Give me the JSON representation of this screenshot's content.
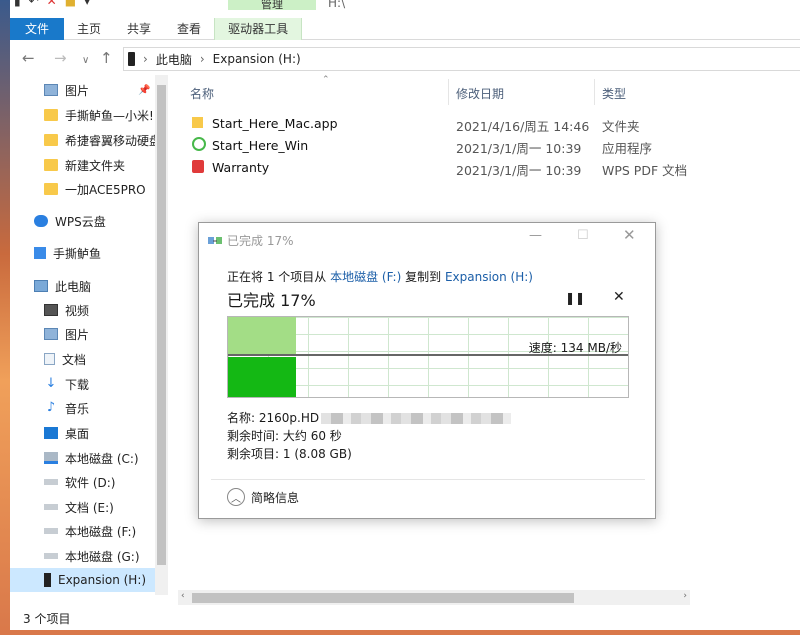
{
  "ribbon": {
    "manage_tab": "管理",
    "path_title": "H:\\",
    "tabs": [
      "文件",
      "主页",
      "共享",
      "查看",
      "驱动器工具"
    ]
  },
  "address": {
    "crumbs": [
      "此电脑",
      "Expansion (H:)"
    ]
  },
  "sidebar": {
    "items": [
      {
        "label": "图片",
        "icon": "pictures-icon",
        "pinned": true
      },
      {
        "label": "手撕鲈鱼—小米!",
        "icon": "folder-icon"
      },
      {
        "label": "希捷睿翼移动硬盘",
        "icon": "folder-icon"
      },
      {
        "label": "新建文件夹",
        "icon": "folder-icon"
      },
      {
        "label": "一加ACE5PRO",
        "icon": "folder-icon"
      },
      {
        "label": "WPS云盘",
        "icon": "cloud-icon"
      },
      {
        "label": "手撕鲈鱼",
        "icon": "cloud-drive-icon"
      },
      {
        "label": "此电脑",
        "icon": "computer-icon"
      },
      {
        "label": "视频",
        "icon": "video-icon"
      },
      {
        "label": "图片",
        "icon": "pictures-icon"
      },
      {
        "label": "文档",
        "icon": "documents-icon"
      },
      {
        "label": "下载",
        "icon": "download-icon"
      },
      {
        "label": "音乐",
        "icon": "music-icon"
      },
      {
        "label": "桌面",
        "icon": "desktop-icon"
      },
      {
        "label": "本地磁盘 (C:)",
        "icon": "windows-drive-icon"
      },
      {
        "label": "软件 (D:)",
        "icon": "drive-icon"
      },
      {
        "label": "文档 (E:)",
        "icon": "drive-icon"
      },
      {
        "label": "本地磁盘 (F:)",
        "icon": "drive-icon"
      },
      {
        "label": "本地磁盘 (G:)",
        "icon": "drive-icon"
      },
      {
        "label": "Expansion (H:)",
        "icon": "usb-drive-icon",
        "selected": true
      }
    ]
  },
  "columns": {
    "name": "名称",
    "date": "修改日期",
    "type": "类型"
  },
  "files": [
    {
      "name": "Start_Here_Mac.app",
      "date": "2021/4/16/周五 14:46",
      "type": "文件夹",
      "icon": "folder-icon"
    },
    {
      "name": "Start_Here_Win",
      "date": "2021/3/1/周一 10:39",
      "type": "应用程序",
      "icon": "seagate-app-icon"
    },
    {
      "name": "Warranty",
      "date": "2021/3/1/周一 10:39",
      "type": "WPS PDF 文档",
      "icon": "pdf-icon"
    }
  ],
  "status": {
    "count": "3 个项目"
  },
  "dialog": {
    "title": "已完成 17%",
    "line_prefix": "正在将 1 个项目从 ",
    "source": "本地磁盘 (F:)",
    "line_mid": " 复制到 ",
    "dest": "Expansion (H:)",
    "big_status": "已完成 17%",
    "progress_fraction": 0.17,
    "speed": "速度: 134 MB/秒",
    "name_label": "名称:",
    "name_value": "2160p.HD",
    "time_label": "剩余时间:",
    "time_value": "大约 60 秒",
    "items_label": "剩余项目:",
    "items_value": "1 (8.08 GB)",
    "details": "简略信息"
  },
  "colors": {
    "accent": "#1979ca",
    "graph_light": "#a3dd86",
    "graph_dark": "#14b814",
    "link": "#1c5fa8",
    "selected": "#cce8ff"
  }
}
